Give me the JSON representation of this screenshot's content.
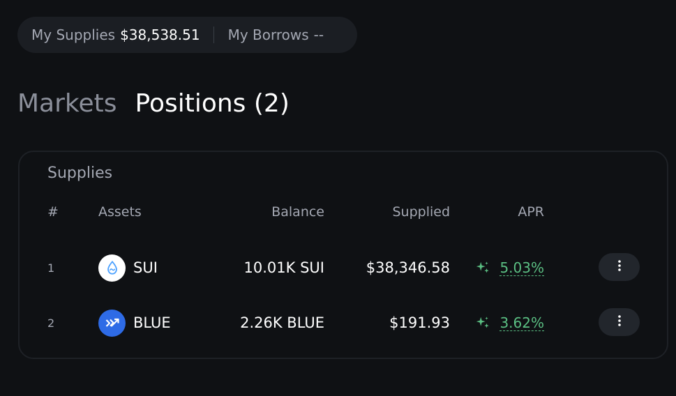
{
  "summary": {
    "supplies_label": "My Supplies",
    "supplies_value": "$38,538.51",
    "borrows_label": "My Borrows",
    "borrows_value": "--"
  },
  "tabs": [
    {
      "label": "Markets",
      "active": false
    },
    {
      "label": "Positions (2)",
      "active": true
    }
  ],
  "supplies": {
    "title": "Supplies",
    "columns": {
      "num": "#",
      "assets": "Assets",
      "balance": "Balance",
      "supplied": "Supplied",
      "apr": "APR"
    },
    "rows": [
      {
        "num": "1",
        "icon": "sui-token-icon",
        "asset": "SUI",
        "balance": "10.01K SUI",
        "supplied": "$38,346.58",
        "apr": "5.03%"
      },
      {
        "num": "2",
        "icon": "blue-token-icon",
        "asset": "BLUE",
        "balance": "2.26K BLUE",
        "supplied": "$191.93",
        "apr": "3.62%"
      }
    ]
  },
  "colors": {
    "background": "#0f1114",
    "apr_green": "#5bbf83",
    "blue_token": "#2e6be6",
    "sui_token": "#4da2ff"
  },
  "icons": {
    "apr": "sparkle-icon",
    "row_menu": "more-vertical-icon"
  }
}
